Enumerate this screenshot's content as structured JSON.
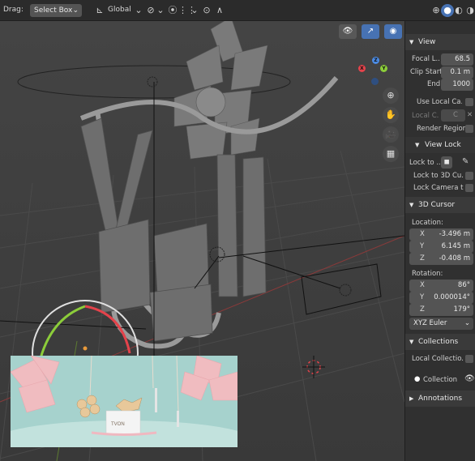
{
  "toolbar": {
    "drag_label": "Drag:",
    "select_mode": "Select Box",
    "transform_orientation": "Global"
  },
  "viewport": {
    "shading_modes": [
      "wireframe",
      "solid",
      "material-preview",
      "rendered"
    ],
    "gizmo_axes": [
      "X",
      "Y",
      "Z"
    ],
    "nav_buttons": [
      "zoom",
      "pan",
      "camera",
      "grid"
    ]
  },
  "sidebar": {
    "view": {
      "header": "View",
      "focal_length_label": "Focal L...",
      "focal_length_value": "68.5",
      "clip_start_label": "Clip Start",
      "clip_start_value": "0.1 m",
      "end_label": "End",
      "end_value": "1000",
      "use_local_camera_label": "Use Local Ca...",
      "local_camera_label": "Local C...",
      "local_camera_short": "C",
      "render_region_label": "Render Region"
    },
    "view_lock": {
      "header": "View Lock",
      "lock_to_label": "Lock to ...",
      "lock_to_3d_cursor_label": "Lock to 3D Cu...",
      "lock_camera_label": "Lock Camera t..."
    },
    "cursor": {
      "header": "3D Cursor",
      "location_label": "Location:",
      "loc_x": "-3.496 m",
      "loc_y": "6.145 m",
      "loc_z": "-0.408 m",
      "rotation_label": "Rotation:",
      "rot_x": "86°",
      "rot_y": "0.000014°",
      "rot_z": "179°",
      "rotation_mode": "XYZ Euler"
    },
    "collections": {
      "header": "Collections",
      "local_collections_label": "Local Collectio...",
      "collection_label": "Collection"
    },
    "annotations": {
      "header": "Annotations"
    }
  },
  "thumbnail": {
    "brand": "TVON"
  },
  "colors": {
    "accent": "#4772b3",
    "axis_x": "#e4434b",
    "axis_y": "#8ccd3a",
    "axis_z": "#4b8be4"
  }
}
